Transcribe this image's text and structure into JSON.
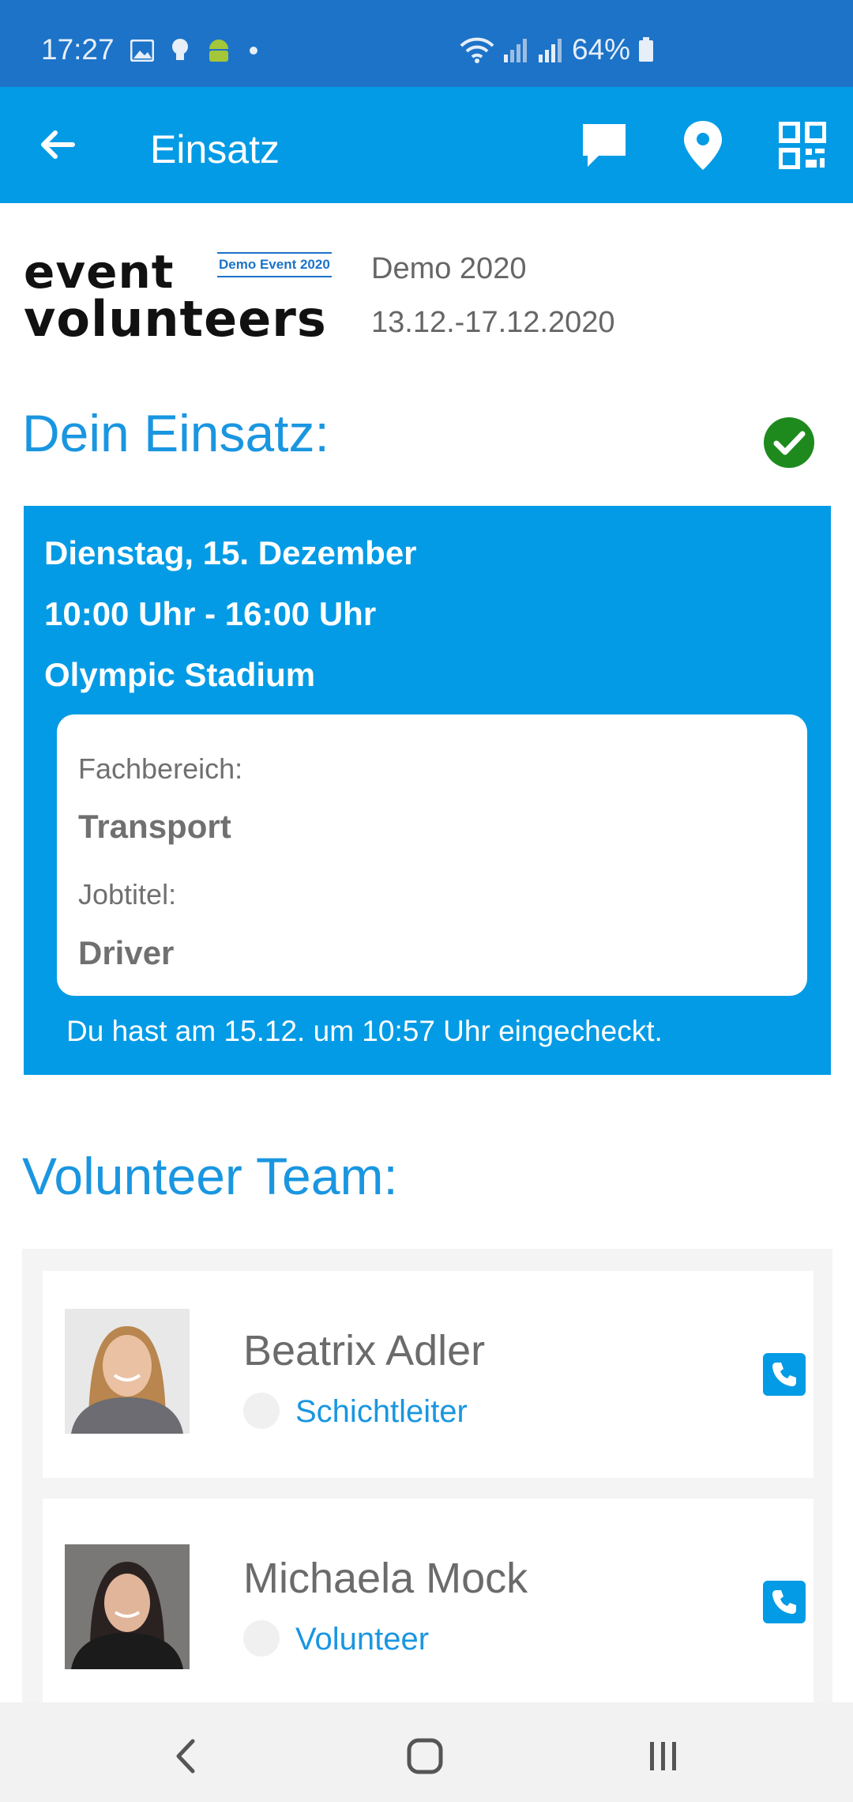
{
  "status_bar": {
    "time": "17:27",
    "battery": "64%",
    "icons": [
      "gallery-icon",
      "bulb-icon",
      "android-icon",
      "dot-icon",
      "wifi-icon",
      "signal-icon",
      "signal-icon",
      "battery-icon"
    ]
  },
  "app_bar": {
    "title": "Einsatz",
    "actions": [
      "chat-icon",
      "location-pin-icon",
      "qr-code-icon"
    ]
  },
  "event": {
    "logo_line1": "event",
    "logo_line2": "volunteers",
    "logo_badge": "Demo Event 2020",
    "name": "Demo 2020",
    "dates": "13.12.-17.12.2020"
  },
  "assignment": {
    "section_title": "Dein Einsatz:",
    "status": "checked-in",
    "date": "Dienstag, 15. Dezember",
    "time": "10:00 Uhr - 16:00 Uhr",
    "location": "Olympic Stadium",
    "department_label": "Fachbereich:",
    "department_value": "Transport",
    "job_label": "Jobtitel:",
    "job_value": "Driver",
    "checkin_note": "Du hast am 15.12. um 10:57 Uhr eingecheckt."
  },
  "team": {
    "section_title": "Volunteer Team:",
    "members": [
      {
        "name": "Beatrix Adler",
        "role": "Schichtleiter"
      },
      {
        "name": "Michaela Mock",
        "role": "Volunteer"
      }
    ]
  },
  "colors": {
    "status_bar": "#1c73c8",
    "app_bar": "#039be5",
    "accent_text": "#1a96e0",
    "check_green": "#1e8a1e"
  }
}
